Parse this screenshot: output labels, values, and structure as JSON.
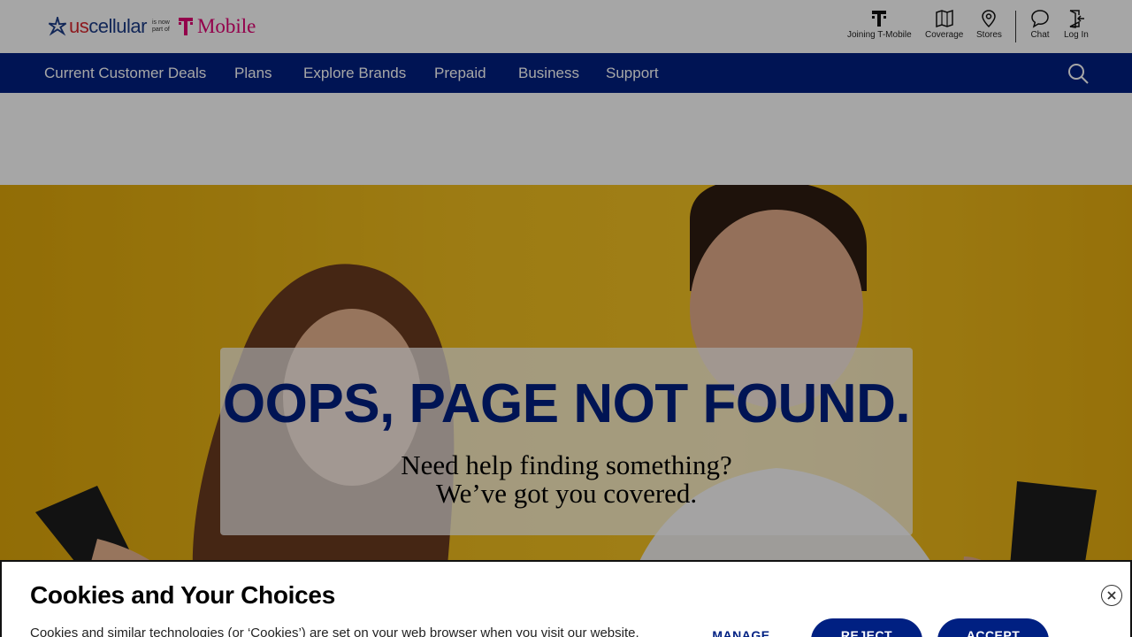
{
  "header": {
    "logo": {
      "brand_us": "us",
      "brand_cellular": "cellular",
      "is_now_part_of": "is now part of",
      "partner": "Mobile"
    },
    "utility_links": [
      {
        "label": "Joining T-Mobile",
        "icon": "t-mobile-icon"
      },
      {
        "label": "Coverage",
        "icon": "map-icon"
      },
      {
        "label": "Stores",
        "icon": "location-pin-icon"
      },
      {
        "label": "Chat",
        "icon": "chat-bubble-icon"
      },
      {
        "label": "Log In",
        "icon": "login-icon"
      }
    ]
  },
  "nav": {
    "items": [
      "Current Customer Deals",
      "Plans",
      "Explore Brands",
      "Prepaid",
      "Business",
      "Support"
    ],
    "search_icon": "search-icon"
  },
  "hero": {
    "title": "OOPS, PAGE NOT FOUND.",
    "subtitle_line1": "Need help finding something?",
    "subtitle_line2": "We’ve got you covered."
  },
  "cookie_banner": {
    "title": "Cookies and Your Choices",
    "text": "Cookies and similar technologies (or ‘Cookies’) are set on your web browser when you visit our website.",
    "manage_label": "MANAGE",
    "reject_label": "REJECT",
    "accept_label": "ACCEPT",
    "close_icon": "close-icon"
  },
  "colors": {
    "brand_blue": "#002082",
    "tmobile_magenta": "#e20074",
    "uscellular_red": "#d9272e",
    "hero_yellow": "#f1be1e"
  }
}
